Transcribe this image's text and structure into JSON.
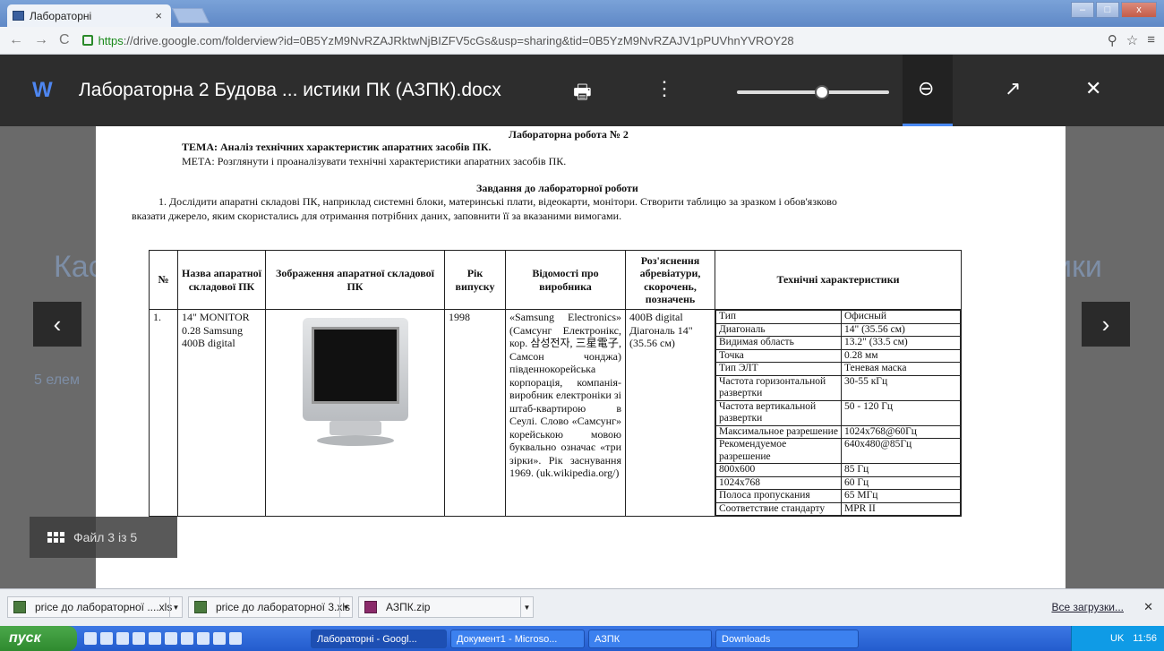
{
  "browser": {
    "tab_title": "Лабораторні",
    "tab_close": "×",
    "url_https": "https",
    "url_rest": "://drive.google.com/folderview?id=0B5YzM9NvRZAJRktwNjBIZFV5cGs&usp=sharing&tid=0B5YzM9NvRZAJV1pPUVhnYVROY28",
    "window_buttons": [
      "–",
      "□",
      "x"
    ]
  },
  "viewer": {
    "app_letter": "W",
    "doc_title": "Лабораторна 2 Будова ... истики ПК (АЗПК).docx",
    "print_icon": "🖶",
    "more_icon": "⋮",
    "zoom_icon": "⊖",
    "popout_icon": "↗",
    "close_icon": "✕",
    "zoom_level": 0.56,
    "prev_arrow": "‹",
    "next_arrow": "›",
    "file_counter": "Файл 3 із 5",
    "background_text": [
      "Кас",
      "ики",
      "5 елем"
    ]
  },
  "document": {
    "heading": "Лабораторна робота № 2",
    "tema": "ТЕМА: Аналіз технічних характеристик апаратних засобів ПК.",
    "meta": "МЕТА: Розглянути і проаналізувати технічні характеристики апаратних засобів ПК.",
    "tasks_heading": "Завдання до лабораторної роботи",
    "task1_line1": "1. Дослідити апаратні складові ПК, наприклад системні блоки, материнські плати, відеокарти, монітори. Створити таблицю за зразком і обов'язково",
    "task1_line2": "вказати джерело, яким скористались для отримання потрібних даних, заповнити її за вказаними вимогами.",
    "table": {
      "headers": [
        "№",
        "Назва апаратної складової ПК",
        "Зображення апаратної складової ПК",
        "Рік випуску",
        "Відомості про виробника",
        "Роз'яснення абревіатури, скорочень, позначень",
        "Технічні характеристики"
      ],
      "row": {
        "num": "1.",
        "name": "14\" MONITOR 0.28 Samsung 400B digital",
        "year": "1998",
        "maker": "«Samsung Electronics» (Самсунг Електронікс, кор. 삼성전자, 三星電子, Самсон чонджа) південнокорейська корпорація, компанія-виробник електроніки зі штаб-квартирою в Сеулі. Слово «Самсунг» корейською мовою буквально означає «три зірки». Рік заснування 1969. (uk.wikipedia.org/)",
        "abbr": "400B digital Діагональ 14\" (35.56 см)",
        "specs": [
          [
            "Тип",
            "Офисный"
          ],
          [
            "Диагональ",
            "14\" (35.56 см)"
          ],
          [
            "Видимая область",
            "13.2\" (33.5 см)"
          ],
          [
            "Точка",
            "0.28 мм"
          ],
          [
            "Тип ЭЛТ",
            "Теневая маска"
          ],
          [
            "Частота горизонтальной развертки",
            "30-55 кГц"
          ],
          [
            "Частота вертикальной развертки",
            "50 - 120 Гц"
          ],
          [
            "Максимальное разрешение",
            "1024x768@60Гц"
          ],
          [
            "Рекомендуемое разрешение",
            "640x480@85Гц"
          ],
          [
            "800x600",
            "85 Гц"
          ],
          [
            "1024x768",
            "60 Гц"
          ],
          [
            "Полоса пропускания",
            "65 МГц"
          ],
          [
            "Соответствие стандарту",
            "MPR II"
          ]
        ]
      }
    }
  },
  "downloads": {
    "items": [
      "price до лабораторної ....xls",
      "price до лабораторної 3.xls",
      "АЗПК.zip"
    ],
    "all_label": "Все загрузки...",
    "close": "✕"
  },
  "taskbar": {
    "start": "пуск",
    "tasks": [
      "Лабораторні - Googl...",
      "Документ1 - Microso...",
      "АЗПК",
      "Downloads"
    ],
    "lang": "UK",
    "time": "11:56"
  }
}
